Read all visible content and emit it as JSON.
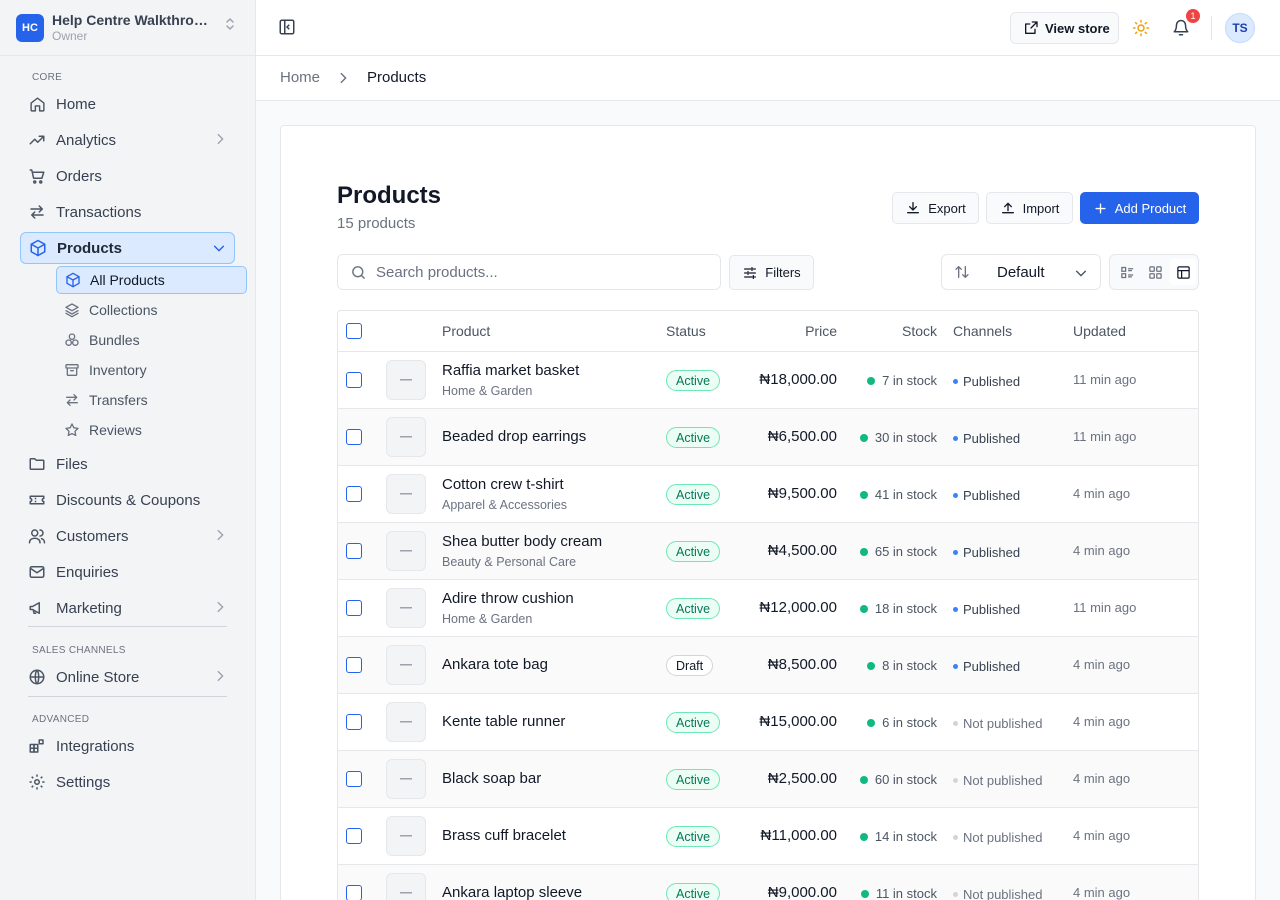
{
  "store": {
    "initials": "HC",
    "name": "Help Centre Walkthrough",
    "role": "Owner"
  },
  "sidebar": {
    "core_label": "CORE",
    "sales_label": "SALES CHANNELS",
    "advanced_label": "ADVANCED",
    "items": {
      "home": "Home",
      "analytics": "Analytics",
      "orders": "Orders",
      "transactions": "Transactions",
      "products": "Products",
      "files": "Files",
      "discounts": "Discounts & Coupons",
      "customers": "Customers",
      "enquiries": "Enquiries",
      "marketing": "Marketing",
      "online_store": "Online Store",
      "integrations": "Integrations",
      "settings": "Settings"
    },
    "product_sub": {
      "all": "All Products",
      "collections": "Collections",
      "bundles": "Bundles",
      "inventory": "Inventory",
      "transfers": "Transfers",
      "reviews": "Reviews"
    }
  },
  "header": {
    "view_store": "View store",
    "notif_count": "1",
    "avatar": "TS"
  },
  "breadcrumb": {
    "home": "Home",
    "current": "Products"
  },
  "page": {
    "title": "Products",
    "count": "15 products",
    "export": "Export",
    "import": "Import",
    "add": "Add Product",
    "search_placeholder": "Search products...",
    "filters": "Filters",
    "sort": "Default"
  },
  "table": {
    "headers": {
      "product": "Product",
      "status": "Status",
      "price": "Price",
      "stock": "Stock",
      "channels": "Channels",
      "updated": "Updated"
    },
    "rows": [
      {
        "name": "Raffia market basket",
        "category": "Home & Garden",
        "status": "Active",
        "price": "₦18,000.00",
        "stock": "7 in stock",
        "channel": "Published",
        "updated": "11 min ago"
      },
      {
        "name": "Beaded drop earrings",
        "category": "",
        "status": "Active",
        "price": "₦6,500.00",
        "stock": "30 in stock",
        "channel": "Published",
        "updated": "11 min ago"
      },
      {
        "name": "Cotton crew t-shirt",
        "category": "Apparel & Accessories",
        "status": "Active",
        "price": "₦9,500.00",
        "stock": "41 in stock",
        "channel": "Published",
        "updated": "4 min ago"
      },
      {
        "name": "Shea butter body cream",
        "category": "Beauty & Personal Care",
        "status": "Active",
        "price": "₦4,500.00",
        "stock": "65 in stock",
        "channel": "Published",
        "updated": "4 min ago"
      },
      {
        "name": "Adire throw cushion",
        "category": "Home & Garden",
        "status": "Active",
        "price": "₦12,000.00",
        "stock": "18 in stock",
        "channel": "Published",
        "updated": "11 min ago"
      },
      {
        "name": "Ankara tote bag",
        "category": "",
        "status": "Draft",
        "price": "₦8,500.00",
        "stock": "8 in stock",
        "channel": "Published",
        "updated": "4 min ago"
      },
      {
        "name": "Kente table runner",
        "category": "",
        "status": "Active",
        "price": "₦15,000.00",
        "stock": "6 in stock",
        "channel": "Not published",
        "updated": "4 min ago"
      },
      {
        "name": "Black soap bar",
        "category": "",
        "status": "Active",
        "price": "₦2,500.00",
        "stock": "60 in stock",
        "channel": "Not published",
        "updated": "4 min ago"
      },
      {
        "name": "Brass cuff bracelet",
        "category": "",
        "status": "Active",
        "price": "₦11,000.00",
        "stock": "14 in stock",
        "channel": "Not published",
        "updated": "4 min ago"
      },
      {
        "name": "Ankara laptop sleeve",
        "category": "",
        "status": "Active",
        "price": "₦9,000.00",
        "stock": "11 in stock",
        "channel": "Not published",
        "updated": "4 min ago"
      }
    ]
  },
  "colors": {
    "accent": "#2563eb",
    "active_green": "#047857",
    "stock_dot": "#10b981",
    "notif_red": "#ef4444"
  }
}
